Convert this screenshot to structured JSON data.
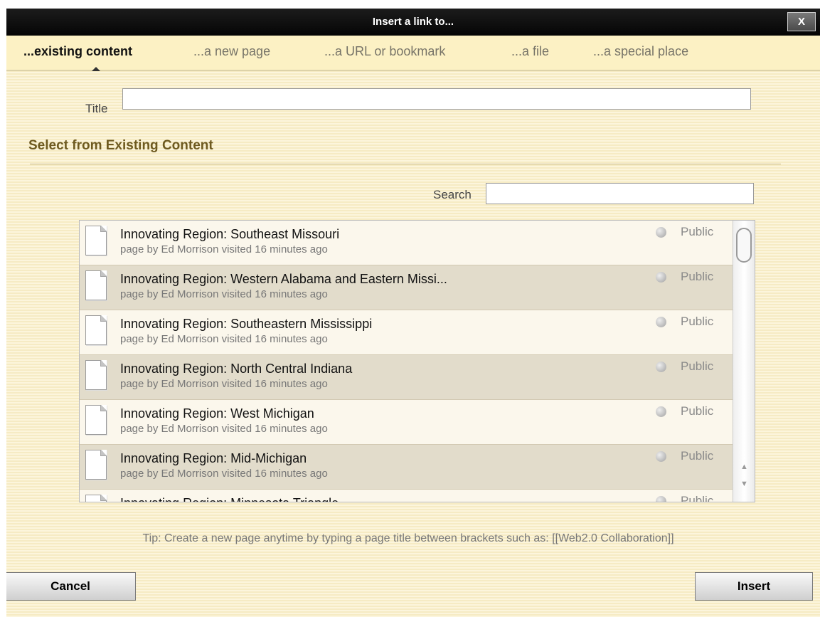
{
  "dialog": {
    "title": "Insert a link to...",
    "close_label": "X"
  },
  "tabs": [
    {
      "label": "...existing content",
      "active": true
    },
    {
      "label": "...a new page",
      "active": false
    },
    {
      "label": "...a URL or bookmark",
      "active": false
    },
    {
      "label": "...a file",
      "active": false
    },
    {
      "label": "...a special place",
      "active": false
    }
  ],
  "form": {
    "title_label": "Title",
    "title_value": ""
  },
  "section": {
    "heading": "Select from Existing Content"
  },
  "search": {
    "label": "Search",
    "value": ""
  },
  "list": {
    "items": [
      {
        "title": "Innovating Region: Southeast Missouri",
        "meta": "page by Ed Morrison visited 16 minutes ago",
        "visibility": "Public",
        "icon": "page-icon"
      },
      {
        "title": "Innovating Region: Western Alabama and Eastern Missi...",
        "meta": "page by Ed Morrison visited 16 minutes ago",
        "visibility": "Public",
        "icon": "page-icon"
      },
      {
        "title": "Innovating Region: Southeastern Mississippi",
        "meta": "page by Ed Morrison visited 16 minutes ago",
        "visibility": "Public",
        "icon": "page-icon"
      },
      {
        "title": "Innovating Region: North Central Indiana",
        "meta": "page by Ed Morrison visited 16 minutes ago",
        "visibility": "Public",
        "icon": "page-icon"
      },
      {
        "title": "Innovating Region: West Michigan",
        "meta": "page by Ed Morrison visited 16 minutes ago",
        "visibility": "Public",
        "icon": "page-icon"
      },
      {
        "title": "Innovating Region: Mid-Michigan",
        "meta": "page by Ed Morrison visited 16 minutes ago",
        "visibility": "Public",
        "icon": "page-icon"
      },
      {
        "title": "Innovating Region: Minnesota Triangle",
        "meta": "",
        "visibility": "Public",
        "icon": "page-icon"
      }
    ]
  },
  "tip": "Tip: Create a new page anytime by typing a page title between brackets such as: [[Web2.0 Collaboration]]",
  "buttons": {
    "cancel": "Cancel",
    "insert": "Insert"
  },
  "colors": {
    "titlebar": "#0c0c0c",
    "background": "#fcf5dc",
    "heading": "#6e5a20",
    "row_alt": "#e2dccb"
  }
}
